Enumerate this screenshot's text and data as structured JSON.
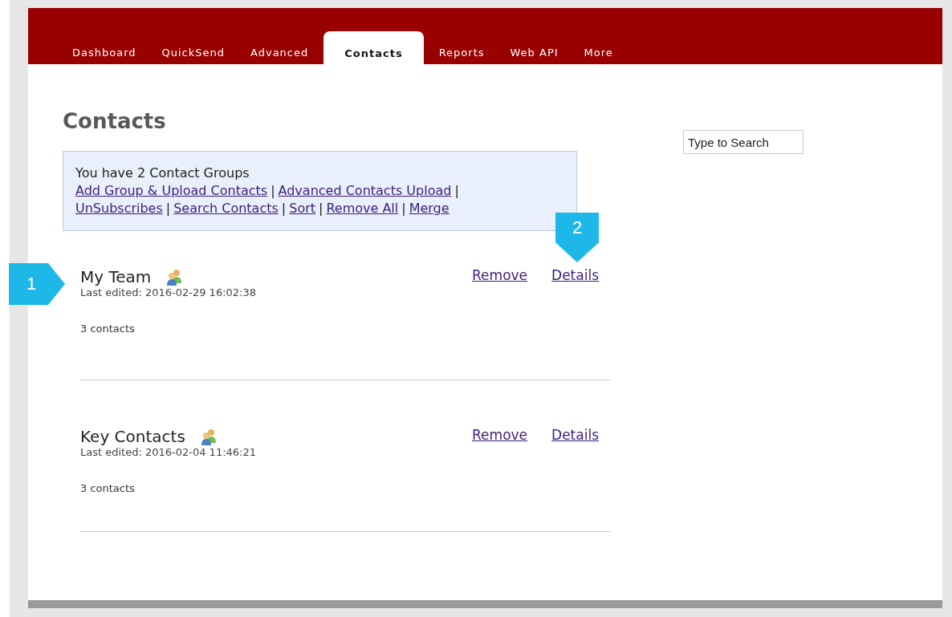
{
  "tabs": [
    {
      "label": "Dashboard",
      "selected": false
    },
    {
      "label": "QuickSend",
      "selected": false
    },
    {
      "label": "Advanced",
      "selected": false
    },
    {
      "label": "Contacts",
      "selected": true
    },
    {
      "label": "Reports",
      "selected": false
    },
    {
      "label": "Web API",
      "selected": false
    },
    {
      "label": "More",
      "selected": false
    }
  ],
  "page_title": "Contacts",
  "search": {
    "placeholder": "Type to Search"
  },
  "info_box": {
    "summary": "You have 2 Contact Groups",
    "lines": [
      [
        {
          "text": "Add Group & Upload Contacts",
          "separator": "|"
        },
        {
          "text": "Advanced Contacts Upload",
          "separator": "|"
        }
      ],
      [
        {
          "text": "UnSubscribes",
          "separator": "|"
        },
        {
          "text": "Search Contacts",
          "separator": "|"
        },
        {
          "text": "Sort",
          "separator": "|"
        },
        {
          "text": "Remove All",
          "separator": "|"
        },
        {
          "text": "Merge"
        }
      ]
    ]
  },
  "groups": [
    {
      "name": "My Team",
      "last_edited": "Last edited: 2016-02-29 16:02:38",
      "count": "3 contacts",
      "actions": [
        "Remove",
        "Details"
      ]
    },
    {
      "name": "Key Contacts",
      "last_edited": "Last edited: 2016-02-04 11:46:21",
      "count": "3 contacts",
      "actions": [
        "Remove",
        "Details"
      ]
    }
  ],
  "callouts": [
    {
      "label": "1",
      "kind": "right"
    },
    {
      "label": "2",
      "kind": "down"
    }
  ]
}
